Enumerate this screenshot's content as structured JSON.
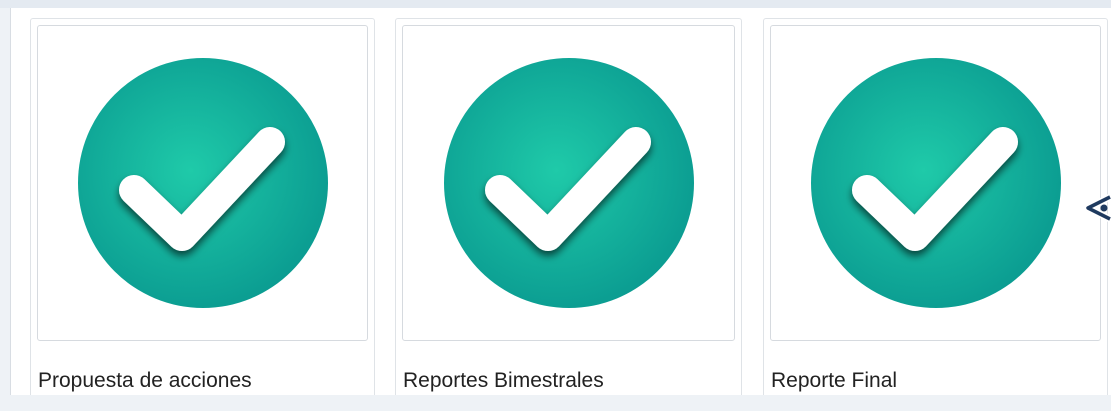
{
  "cards": [
    {
      "title": "Propuesta de acciones",
      "icon": "check-circle-icon",
      "status_color": "#0fa096"
    },
    {
      "title": "Reportes Bimestrales",
      "icon": "check-circle-icon",
      "status_color": "#0fa096"
    },
    {
      "title": "Reporte Final",
      "icon": "check-circle-icon",
      "status_color": "#0fa096"
    }
  ],
  "carousel": {
    "next_icon": "chevron-left-icon"
  },
  "colors": {
    "check_dark": "#0a9a90",
    "check_light": "#17c4a6"
  }
}
